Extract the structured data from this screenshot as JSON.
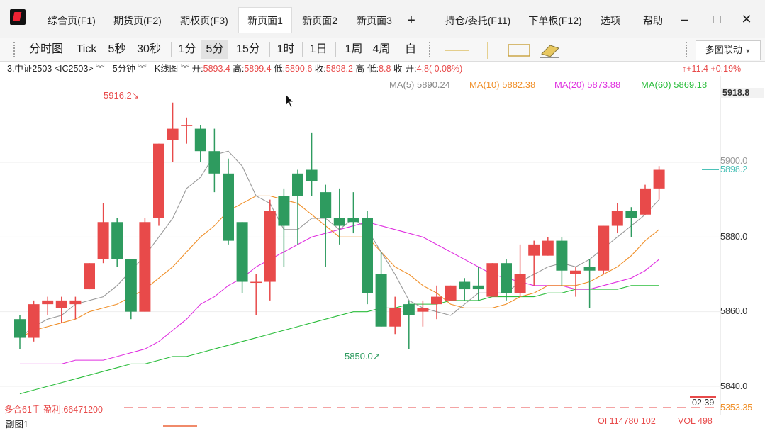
{
  "tabs": [
    {
      "label": "综合页(F1)"
    },
    {
      "label": "期货页(F2)"
    },
    {
      "label": "期权页(F3)"
    },
    {
      "label": "新页面1"
    },
    {
      "label": "新页面2"
    },
    {
      "label": "新页面3"
    },
    {
      "label": "+"
    },
    {
      "label": "持仓/委托(F11)"
    },
    {
      "label": "下单板(F12)"
    },
    {
      "label": "选项"
    },
    {
      "label": "帮助"
    }
  ],
  "window": {
    "minimize": "–",
    "maximize": "□",
    "close": "✕"
  },
  "toolbar": {
    "periods": [
      "分时图",
      "Tick",
      "5秒",
      "30秒",
      "1分",
      "5分",
      "15分",
      "1时",
      "1日",
      "1周",
      "4周",
      "自"
    ],
    "link_button": "多图联动"
  },
  "info": {
    "symbol": "3.中证2503 <IC2503>",
    "period": "- 5分钟",
    "chart_type": "- K线图",
    "open_label": "开:",
    "open": "5893.4",
    "high_label": "高:",
    "high": "5899.4",
    "low_label": "低:",
    "low": "5890.6",
    "close_label": "收:",
    "close": "5898.2",
    "hl_label": "高-低:",
    "hl": "8.8",
    "co_label": "收-开:",
    "co": "4.8( 0.08%)",
    "change": "↑+11.4 +0.19%"
  },
  "ma": {
    "ma5": "MA(5) 5890.24",
    "ma10": "MA(10) 5882.38",
    "ma20": "MA(20) 5873.88",
    "ma60": "MA(60) 5869.18"
  },
  "price_axis": {
    "top": "5918.8",
    "current": "5898.2",
    "ticks": [
      "5900.0",
      "5880.0",
      "5860.0",
      "5840.0"
    ],
    "sub_value": "5353.35"
  },
  "annotations": {
    "high": "5916.2↘",
    "low": "5850.0↗"
  },
  "position": {
    "text": "多合61手 盈利:66471200",
    "time": "02:39"
  },
  "bottom": {
    "label": "副图1",
    "oi": "OI 114780 102",
    "vol": "VOL 498"
  },
  "colors": {
    "up": "#e84a4a",
    "down": "#2e9b5f",
    "ma5": "#999999",
    "ma10": "#f0902a",
    "ma20": "#e030e0",
    "ma60": "#2bbd3c"
  },
  "chart_data": {
    "type": "candlestick",
    "ylim": [
      5836,
      5922
    ],
    "candles": [
      [
        5858,
        5853,
        5859,
        5850
      ],
      [
        5853,
        5862,
        5863,
        5852
      ],
      [
        5862,
        5863,
        5864,
        5859
      ],
      [
        5861,
        5863,
        5864,
        5857
      ],
      [
        5862,
        5863,
        5864,
        5858
      ],
      [
        5866,
        5873,
        5873,
        5866
      ],
      [
        5874,
        5884,
        5889,
        5873
      ],
      [
        5884,
        5874,
        5885,
        5872
      ],
      [
        5874,
        5860,
        5872,
        5858
      ],
      [
        5860,
        5884,
        5885,
        5860
      ],
      [
        5885,
        5905,
        5905,
        5883
      ],
      [
        5906,
        5909,
        5916,
        5900
      ],
      [
        5910,
        5910,
        5912,
        5905
      ],
      [
        5909,
        5903,
        5910,
        5900
      ],
      [
        5903,
        5897,
        5909,
        5892
      ],
      [
        5897,
        5879,
        5901,
        5878
      ],
      [
        5884,
        5868,
        5884,
        5865
      ],
      [
        5868,
        5868,
        5870,
        5859
      ],
      [
        5868,
        5887,
        5890,
        5863
      ],
      [
        5891,
        5883,
        5893,
        5872
      ],
      [
        5897,
        5891,
        5898,
        5878
      ],
      [
        5898,
        5895,
        5908,
        5891
      ],
      [
        5892,
        5885,
        5894,
        5872
      ],
      [
        5885,
        5883,
        5893,
        5878
      ],
      [
        5885,
        5884,
        5892,
        5881
      ],
      [
        5885,
        5865,
        5887,
        5862
      ],
      [
        5870,
        5856,
        5876,
        5856
      ],
      [
        5856,
        5861,
        5864,
        5854
      ],
      [
        5862,
        5859,
        5863,
        5850
      ],
      [
        5860,
        5861,
        5863,
        5856
      ],
      [
        5862,
        5864,
        5867,
        5858
      ],
      [
        5863,
        5867,
        5867,
        5863
      ],
      [
        5868,
        5866,
        5869,
        5863
      ],
      [
        5867,
        5866,
        5872,
        5863
      ],
      [
        5864,
        5873,
        5873,
        5864
      ],
      [
        5873,
        5865,
        5874,
        5863
      ],
      [
        5865,
        5870,
        5878,
        5864
      ],
      [
        5875,
        5878,
        5879,
        5867
      ],
      [
        5875,
        5879,
        5880,
        5875
      ],
      [
        5879,
        5871,
        5880,
        5867
      ],
      [
        5870,
        5871,
        5872,
        5864
      ],
      [
        5872,
        5871,
        5874,
        5861
      ],
      [
        5871,
        5883,
        5883,
        5870
      ],
      [
        5883,
        5887,
        5889,
        5881
      ],
      [
        5887,
        5885,
        5888,
        5880
      ],
      [
        5886,
        5893,
        5894,
        5886
      ],
      [
        5893,
        5898,
        5899,
        5890
      ]
    ],
    "ma5": [
      5853,
      5856,
      5858,
      5859,
      5862,
      5863,
      5864,
      5867,
      5871,
      5875,
      5880,
      5885,
      5893,
      5896,
      5902,
      5903,
      5899,
      5891,
      5889,
      5882,
      5882,
      5885,
      5885,
      5882,
      5885,
      5882,
      5876,
      5870,
      5863,
      5861,
      5860,
      5859,
      5862,
      5865,
      5865,
      5865,
      5868,
      5870,
      5872,
      5873,
      5872,
      5874,
      5877,
      5880,
      5883,
      5886,
      5890
    ],
    "ma10": [
      5853,
      5855,
      5856,
      5857,
      5858,
      5860,
      5861,
      5862,
      5864,
      5866,
      5869,
      5872,
      5876,
      5880,
      5883,
      5887,
      5889,
      5891,
      5891,
      5890,
      5889,
      5886,
      5883,
      5880,
      5880,
      5880,
      5876,
      5872,
      5870,
      5867,
      5865,
      5862,
      5861,
      5861,
      5861,
      5862,
      5864,
      5865,
      5867,
      5867,
      5867,
      5868,
      5870,
      5872,
      5875,
      5879,
      5882
    ],
    "ma20": [
      5846,
      5846,
      5846,
      5846,
      5847,
      5847,
      5847,
      5848,
      5849,
      5850,
      5852,
      5855,
      5858,
      5862,
      5864,
      5867,
      5869,
      5872,
      5874,
      5876,
      5878,
      5880,
      5881,
      5882,
      5883,
      5884,
      5883,
      5882,
      5881,
      5880,
      5878,
      5876,
      5874,
      5872,
      5870,
      5869,
      5868,
      5867,
      5867,
      5867,
      5866,
      5866,
      5867,
      5868,
      5869,
      5871,
      5874
    ],
    "ma60": [
      5838,
      5839,
      5840,
      5841,
      5842,
      5843,
      5844,
      5845,
      5846,
      5846,
      5847,
      5848,
      5848,
      5849,
      5850,
      5851,
      5852,
      5853,
      5854,
      5855,
      5856,
      5857,
      5858,
      5859,
      5860,
      5860,
      5861,
      5861,
      5862,
      5862,
      5862,
      5863,
      5863,
      5863,
      5864,
      5864,
      5864,
      5864,
      5865,
      5865,
      5866,
      5866,
      5866,
      5866,
      5867,
      5867,
      5867
    ]
  }
}
